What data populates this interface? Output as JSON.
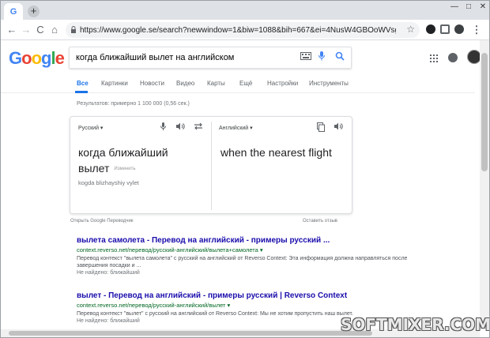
{
  "browser": {
    "tab_favicon": "G",
    "new_tab": "+",
    "url": "https://www.google.se/search?newwindow=1&biw=1088&bih=667&ei=4NusW4GBOoWVsgH-zIKw...",
    "icons": [
      "back-icon",
      "forward-icon",
      "reload-icon",
      "home-icon",
      "lock-icon",
      "star-icon",
      "minimize-icon",
      "maximize-icon",
      "close-icon"
    ],
    "controls": {
      "back": "←",
      "forward": "→",
      "reload": "C",
      "home": "⌂",
      "lock": "🔒",
      "star": "☆",
      "minimize": "—",
      "maximize": "□",
      "close": "✕"
    }
  },
  "google": {
    "logo_letters": [
      "G",
      "o",
      "o",
      "g",
      "l",
      "e"
    ],
    "logo_colors": [
      "#4285f4",
      "#ea4335",
      "#fbbc05",
      "#4285f4",
      "#34a853",
      "#ea4335"
    ],
    "query": "когда ближайший вылет  на английском",
    "icons": {
      "keyboard": "⌨",
      "mic": "🎤",
      "search": "🔍",
      "apps": "⋮⋮⋮"
    }
  },
  "nav": {
    "items": [
      "Все",
      "Картинки",
      "Новости",
      "Видео",
      "Карты",
      "Ещё",
      "Настройки",
      "Инструменты"
    ]
  },
  "stats": "Результатов: примерно 1 100 000 (0,56 сек.)",
  "translate": {
    "source_lang": "Русский",
    "target_lang": "Английский",
    "source_text": "когда ближайший вылет",
    "edit_label": "Изменить",
    "transliteration": "kogda blizhayshiy vylet",
    "target_text": "when the nearest flight",
    "open_link": "Открыть Google Переводчик",
    "feedback_link": "Оставить отзыв"
  },
  "results": [
    {
      "title": "вылета самолета - Перевод на английский - примеры русский ...",
      "url": "context.reverso.net/перевод/русский-английский/вылета+самолета ▾",
      "snippet": "Перевод контекст \"вылета самолета\" с русский на английский от Reverso Context: Эта информация должна направляться после завершения посадки и ...",
      "missing": "Не найдено: ближайший"
    },
    {
      "title": "вылет - Перевод на английский - примеры русский | Reverso Context",
      "url": "context.reverso.net/перевод/русский-английский/вылет ▾",
      "snippet": "Перевод контекст \"вылет\" с русский на английский от Reverso Context: Мы не хотим пропустить наш вылет.",
      "missing": "Не найдено: ближайший"
    }
  ],
  "watermark": "SOFTMIXER.COM"
}
